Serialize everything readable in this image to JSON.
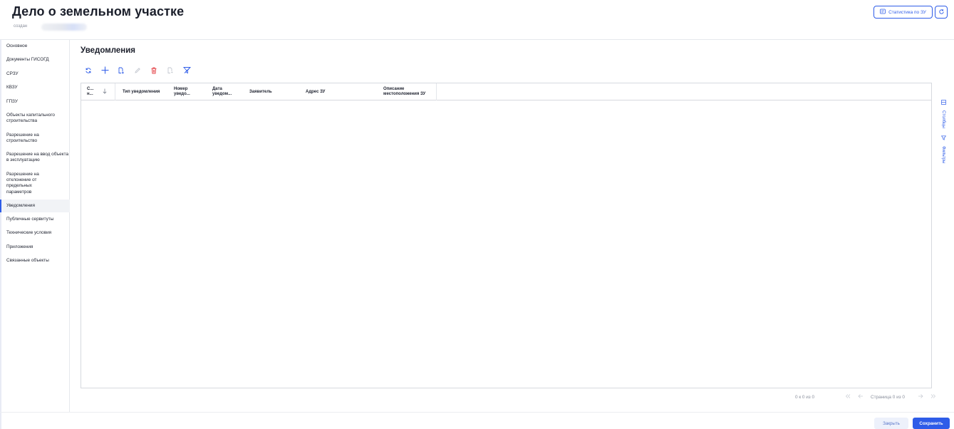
{
  "header": {
    "title": "Дело о земельном участке",
    "created_label": "создан",
    "stats_button": "Статистика по ЗУ"
  },
  "sidebar": {
    "items": [
      {
        "label": "Основное"
      },
      {
        "label": "Документы ГИСОГД"
      },
      {
        "label": "СРЗУ"
      },
      {
        "label": "КВЗУ"
      },
      {
        "label": "ГПЗУ"
      },
      {
        "label": "Объекты капитального строительства"
      },
      {
        "label": "Разрешение на строительство"
      },
      {
        "label": "Разрешение на ввод объекта в эксплуатацию"
      },
      {
        "label": "Разрешение на отклонение от предельных параметров"
      },
      {
        "label": "Уведомления"
      },
      {
        "label": "Публичные сервитуты"
      },
      {
        "label": "Технические условия"
      },
      {
        "label": "Приложения"
      },
      {
        "label": "Связанные объекты"
      }
    ],
    "active_index": 9
  },
  "main": {
    "section_title": "Уведомления",
    "columns": [
      {
        "label": "С... н..."
      },
      {
        "label": "Тип уведомления"
      },
      {
        "label": "Номер уведо..."
      },
      {
        "label": "Дата уведом..."
      },
      {
        "label": "Заявитель"
      },
      {
        "label": "Адрес ЗУ"
      },
      {
        "label": "Описание местоположения ЗУ"
      }
    ],
    "side_tabs": {
      "columns": "Столбцы",
      "filters": "Фильтры"
    },
    "pager": {
      "range": "0 к 0 из 0",
      "page": "Страница 0 из 0"
    }
  },
  "footer": {
    "close_label": "Закрыть",
    "save_label": "Сохранить"
  },
  "colors": {
    "accent": "#2e5ce8",
    "delete": "#e5484d",
    "disabled": "#c4c8d0"
  }
}
